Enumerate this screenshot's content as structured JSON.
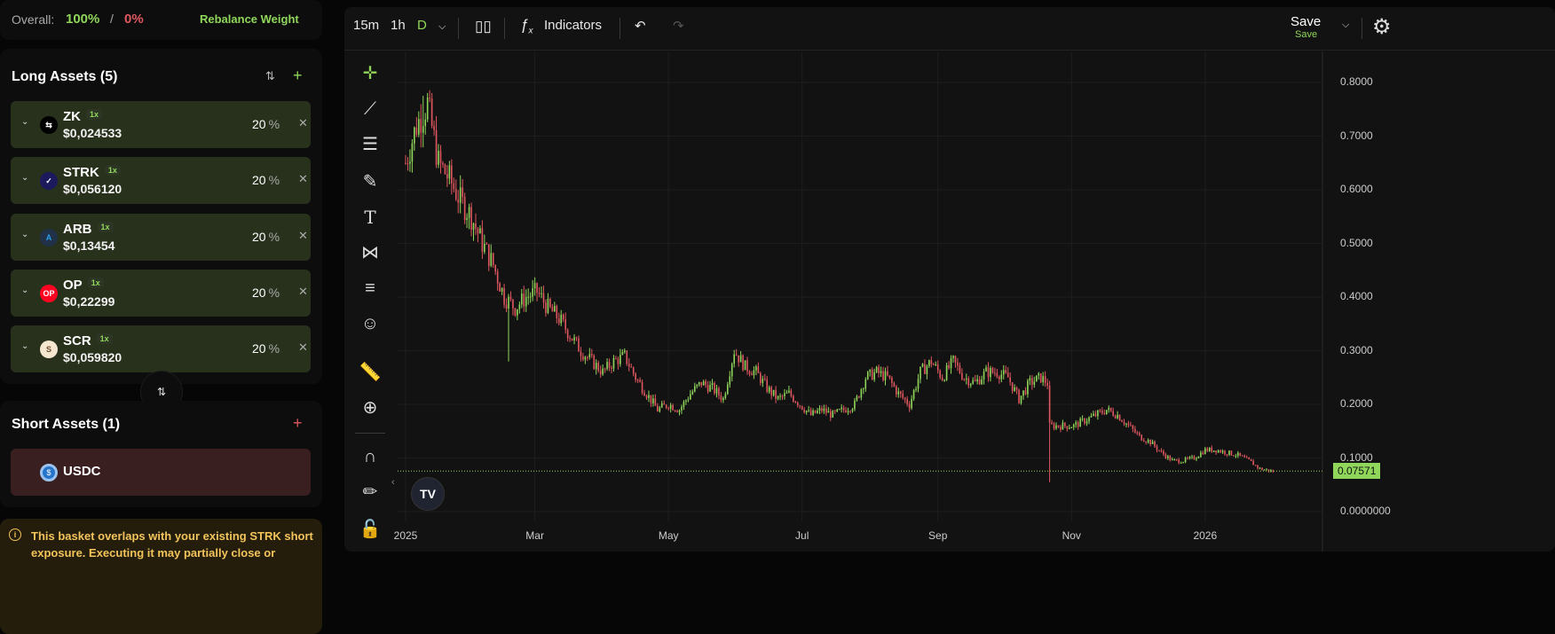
{
  "overall": {
    "label": "Overall:",
    "long_pct": "100%",
    "sep": "/",
    "short_pct": "0%",
    "rebalance": "Rebalance Weight"
  },
  "long": {
    "title": "Long Assets (5)",
    "items": [
      {
        "symbol": "ZK",
        "lev": "1x",
        "price": "$0,024533",
        "pct": "20",
        "unit": "%",
        "logo_bg": "#000",
        "logo_fg": "#fff",
        "logo": "⇆"
      },
      {
        "symbol": "STRK",
        "lev": "1x",
        "price": "$0,056120",
        "pct": "20",
        "unit": "%",
        "logo_bg": "#1c1a5c",
        "logo_fg": "#fff",
        "logo": "✓"
      },
      {
        "symbol": "ARB",
        "lev": "1x",
        "price": "$0,13454",
        "pct": "20",
        "unit": "%",
        "logo_bg": "#213147",
        "logo_fg": "#28a0f0",
        "logo": "A"
      },
      {
        "symbol": "OP",
        "lev": "1x",
        "price": "$0,22299",
        "pct": "20",
        "unit": "%",
        "logo_bg": "#ff0420",
        "logo_fg": "#fff",
        "logo": "OP"
      },
      {
        "symbol": "SCR",
        "lev": "1x",
        "price": "$0,059820",
        "pct": "20",
        "unit": "%",
        "logo_bg": "#f5e6d0",
        "logo_fg": "#6b4a2b",
        "logo": "S"
      }
    ]
  },
  "short": {
    "title": "Short Assets (1)",
    "items": [
      {
        "symbol": "USDC"
      }
    ]
  },
  "warning": "This basket overlaps with your existing STRK short exposure. Executing it may partially close or",
  "toolbar": {
    "intervals": [
      "15m",
      "1h",
      "D"
    ],
    "indicators": "Indicators",
    "save": "Save",
    "save_sub": "Save"
  },
  "colors": {
    "up": "#8fd65a",
    "down": "#e0575f",
    "accent": "#8fd65a"
  },
  "chart_data": {
    "type": "candlestick",
    "ylim": [
      0,
      0.85
    ],
    "y_ticks": [
      "0.8000",
      "0.7000",
      "0.6000",
      "0.5000",
      "0.4000",
      "0.3000",
      "0.2000",
      "0.1000",
      "0.0000000"
    ],
    "x_ticks": [
      {
        "label": "2025",
        "day": 0
      },
      {
        "label": "Mar",
        "day": 59
      },
      {
        "label": "May",
        "day": 120
      },
      {
        "label": "Jul",
        "day": 181
      },
      {
        "label": "Sep",
        "day": 243
      },
      {
        "label": "Nov",
        "day": 304
      },
      {
        "label": "2026",
        "day": 365
      }
    ],
    "last_price": "0.07571",
    "last_value": 0.07571,
    "approx_close_by_day": [
      [
        0,
        0.65
      ],
      [
        5,
        0.72
      ],
      [
        10,
        0.76
      ],
      [
        15,
        0.65
      ],
      [
        20,
        0.62
      ],
      [
        25,
        0.58
      ],
      [
        30,
        0.55
      ],
      [
        35,
        0.5
      ],
      [
        40,
        0.46
      ],
      [
        45,
        0.4
      ],
      [
        50,
        0.38
      ],
      [
        55,
        0.4
      ],
      [
        60,
        0.41
      ],
      [
        65,
        0.38
      ],
      [
        70,
        0.36
      ],
      [
        75,
        0.33
      ],
      [
        80,
        0.3
      ],
      [
        85,
        0.28
      ],
      [
        90,
        0.26
      ],
      [
        95,
        0.28
      ],
      [
        100,
        0.29
      ],
      [
        105,
        0.25
      ],
      [
        110,
        0.22
      ],
      [
        115,
        0.19
      ],
      [
        120,
        0.2
      ],
      [
        125,
        0.19
      ],
      [
        130,
        0.22
      ],
      [
        135,
        0.24
      ],
      [
        140,
        0.23
      ],
      [
        145,
        0.21
      ],
      [
        150,
        0.3
      ],
      [
        155,
        0.27
      ],
      [
        160,
        0.26
      ],
      [
        165,
        0.23
      ],
      [
        170,
        0.21
      ],
      [
        175,
        0.22
      ],
      [
        180,
        0.2
      ],
      [
        185,
        0.18
      ],
      [
        190,
        0.19
      ],
      [
        195,
        0.18
      ],
      [
        200,
        0.19
      ],
      [
        205,
        0.2
      ],
      [
        210,
        0.25
      ],
      [
        215,
        0.26
      ],
      [
        220,
        0.25
      ],
      [
        225,
        0.22
      ],
      [
        230,
        0.2
      ],
      [
        235,
        0.26
      ],
      [
        240,
        0.28
      ],
      [
        245,
        0.25
      ],
      [
        250,
        0.28
      ],
      [
        255,
        0.25
      ],
      [
        260,
        0.24
      ],
      [
        265,
        0.26
      ],
      [
        270,
        0.26
      ],
      [
        275,
        0.25
      ],
      [
        280,
        0.21
      ],
      [
        285,
        0.24
      ],
      [
        290,
        0.25
      ],
      [
        293,
        0.24
      ],
      [
        294,
        0.16
      ],
      [
        300,
        0.16
      ],
      [
        305,
        0.16
      ],
      [
        310,
        0.17
      ],
      [
        315,
        0.18
      ],
      [
        320,
        0.19
      ],
      [
        325,
        0.18
      ],
      [
        330,
        0.16
      ],
      [
        335,
        0.14
      ],
      [
        340,
        0.13
      ],
      [
        345,
        0.11
      ],
      [
        350,
        0.095
      ],
      [
        355,
        0.095
      ],
      [
        360,
        0.1
      ],
      [
        365,
        0.115
      ],
      [
        370,
        0.115
      ],
      [
        375,
        0.11
      ],
      [
        380,
        0.105
      ],
      [
        385,
        0.095
      ],
      [
        390,
        0.08
      ],
      [
        395,
        0.076
      ]
    ]
  }
}
